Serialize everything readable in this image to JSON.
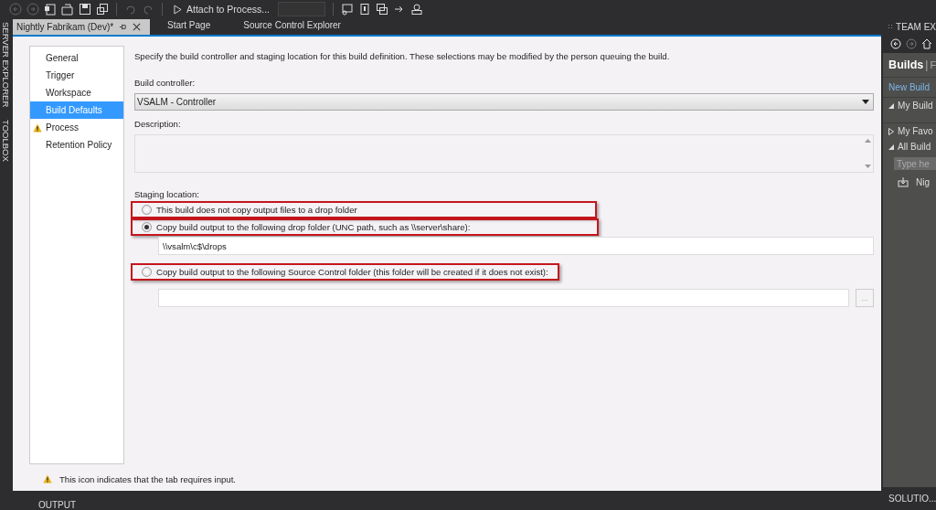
{
  "toolbar": {
    "attach_label": "Attach to Process..."
  },
  "side_strip": [
    "SERVER EXPLORER",
    "TOOLBOX"
  ],
  "tabs": [
    {
      "label": "Nightly Fabrikam (Dev)*",
      "selected": true,
      "kind": "document"
    },
    {
      "label": "Start Page",
      "selected": false,
      "kind": "plain"
    },
    {
      "label": "Source Control Explorer",
      "selected": false,
      "kind": "plain"
    }
  ],
  "nav": [
    {
      "label": "General",
      "selected": false,
      "warning": false
    },
    {
      "label": "Trigger",
      "selected": false,
      "warning": false
    },
    {
      "label": "Workspace",
      "selected": false,
      "warning": false
    },
    {
      "label": "Build Defaults",
      "selected": true,
      "warning": false
    },
    {
      "label": "Process",
      "selected": false,
      "warning": true
    },
    {
      "label": "Retention Policy",
      "selected": false,
      "warning": false
    }
  ],
  "intro": "Specify the build controller and staging location for this build definition. These selections may be modified by the person queuing the build.",
  "build_controller": {
    "label": "Build controller:",
    "value": "VSALM - Controller"
  },
  "description": {
    "label": "Description:"
  },
  "staging": {
    "label": "Staging location:",
    "options": [
      {
        "label": "This build does not copy output files to a drop folder",
        "selected": false,
        "highlighted": true
      },
      {
        "label": "Copy build output to the following drop folder (UNC path, such as \\\\server\\share):",
        "selected": true,
        "highlighted": true
      },
      {
        "label": "Copy build output to the following Source Control folder (this folder will be created if it does not exist):",
        "selected": false,
        "highlighted": true
      }
    ],
    "drop_folder": "\\\\vsalm\\c$\\drops",
    "browse_button": "..."
  },
  "footer_note": "This icon indicates that the tab requires input.",
  "team_explorer": {
    "title": "TEAM EX",
    "heading": "Builds",
    "separator": "|",
    "heading_next": "F",
    "link": "New Build",
    "sections": [
      {
        "label": "My Build",
        "expanded": true
      },
      {
        "label": "My Favo",
        "expanded": false
      },
      {
        "label": "All Build",
        "expanded": true
      }
    ],
    "search_placeholder": "Type he",
    "build_item": "Nig",
    "bottom_tab": "SOLUTIO..."
  },
  "output_tab": "OUTPUT"
}
